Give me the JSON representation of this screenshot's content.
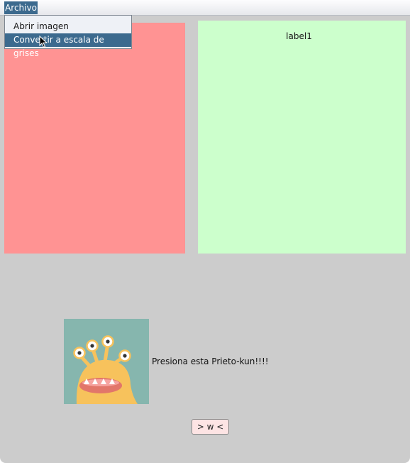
{
  "menubar": {
    "menu_label": "Archivo"
  },
  "dropdown": {
    "items": [
      {
        "label": "Abrir imagen"
      },
      {
        "label": "Convertir a escala de grises"
      }
    ]
  },
  "panels": {
    "image_panel_color": "#ff9393",
    "label_panel_color": "#ccffcc",
    "label_panel_text": "label1"
  },
  "content": {
    "icon": "yellow-monster-icon",
    "prompt_text": "Presiona esta Prieto-kun!!!!",
    "button_label": "> w <"
  },
  "colors": {
    "accent": "#3c6a8e",
    "window_bg": "#cccccc",
    "button_bg": "#fde4e4"
  }
}
